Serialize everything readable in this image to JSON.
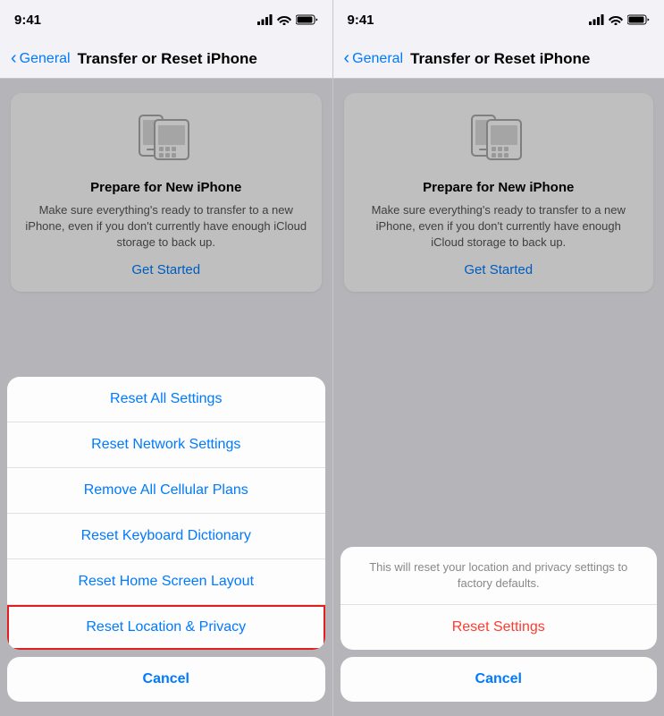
{
  "panel_left": {
    "status": {
      "time": "9:41"
    },
    "nav": {
      "back_label": "General",
      "title": "Transfer or Reset iPhone"
    },
    "prepare_card": {
      "title": "Prepare for New iPhone",
      "description": "Make sure everything's ready to transfer to a new iPhone, even if you don't currently have enough iCloud storage to back up.",
      "cta": "Get Started"
    },
    "action_sheet": {
      "items": [
        "Reset All Settings",
        "Reset Network Settings",
        "Remove All Cellular Plans",
        "Reset Keyboard Dictionary",
        "Reset Home Screen Layout",
        "Reset Location & Privacy"
      ],
      "cancel_label": "Cancel"
    }
  },
  "panel_right": {
    "status": {
      "time": "9:41"
    },
    "nav": {
      "back_label": "General",
      "title": "Transfer or Reset iPhone"
    },
    "prepare_card": {
      "title": "Prepare for New iPhone",
      "description": "Make sure everything's ready to transfer to a new iPhone, even if you don't currently have enough iCloud storage to back up.",
      "cta": "Get Started"
    },
    "confirm_sheet": {
      "description": "This will reset your location and privacy settings to factory defaults.",
      "reset_label": "Reset Settings",
      "cancel_label": "Cancel"
    }
  },
  "icons": {
    "chevron_left": "‹",
    "signal_bars": "▐▌▌▌",
    "wifi": "wifi",
    "battery": "battery"
  }
}
